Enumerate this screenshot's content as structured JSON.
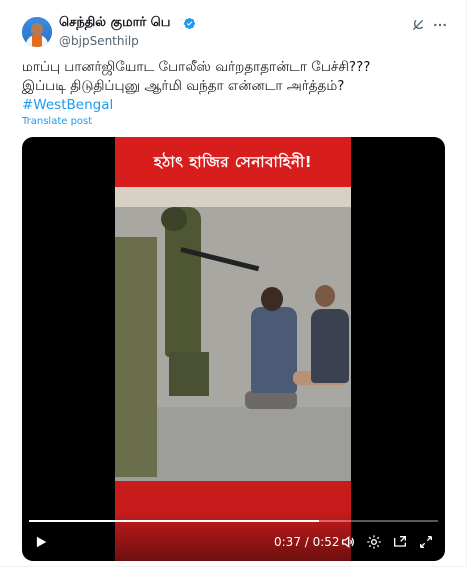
{
  "author": {
    "name": "செந்தில் குமார் பெ",
    "handle": "@bjpSenthilp",
    "verified": true
  },
  "post": {
    "line1": "மாப்பு பானர்ஜியோட போலீஸ் வர்றதாதான்டா பேச்சி???",
    "line2": "இப்படி திடுதிப்புனு ஆர்மி வந்தா என்னடா அர்த்தம்?",
    "hashtag": "#WestBengal",
    "translate_label": "Translate post"
  },
  "video": {
    "banner_text": "হঠাৎ হাজির সেনাবাহিনী!",
    "current_time": "0:37",
    "total_time": "0:52",
    "time_display": "0:37 / 0:52",
    "progress_fraction": 0.71
  },
  "icons": {
    "grok": "grok-icon",
    "more": "more-icon",
    "verified": "verified-badge-icon",
    "play": "play-icon",
    "volume": "volume-icon",
    "settings": "settings-icon",
    "pip": "picture-in-picture-icon",
    "fullscreen": "fullscreen-icon"
  },
  "colors": {
    "accent": "#1d9bf0",
    "banner_red": "#d81d1d"
  }
}
